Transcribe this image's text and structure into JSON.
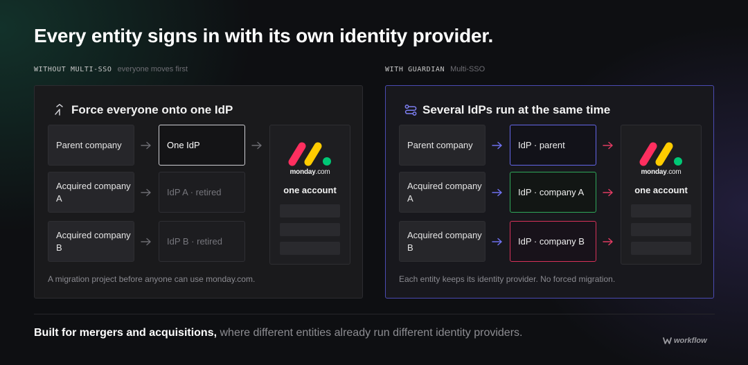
{
  "headline": "Every entity signs in with its own identity provider.",
  "left": {
    "label_code": "WITHOUT MULTI-SSO",
    "label_sub": "everyone moves first",
    "title": "Force everyone onto one IdP",
    "title_icon": "merge-arrow-icon",
    "entities": [
      "Parent company",
      "Acquired company A",
      "Acquired company B"
    ],
    "idps": [
      "One IdP",
      "IdP A · retired",
      "IdP B · retired"
    ],
    "account": {
      "brand": "monday",
      "brand_suffix": ".com",
      "label": "one account"
    },
    "footnote": "A migration project before anyone can use monday.com."
  },
  "right": {
    "label_code": "WITH GUARDIAN",
    "label_sub": "Multi-SSO",
    "title": "Several IdPs run at the same time",
    "title_icon": "routes-icon",
    "entities": [
      "Parent company",
      "Acquired company A",
      "Acquired company B"
    ],
    "idps": [
      "IdP · parent",
      "IdP · company A",
      "IdP · company B"
    ],
    "account": {
      "brand": "monday",
      "brand_suffix": ".com",
      "label": "one account"
    },
    "footnote": "Each entity keeps its identity provider. No forced migration."
  },
  "colors": {
    "idp_parent": "#6466ea",
    "idp_company_a": "#2fa85a",
    "idp_company_b": "#d8325a",
    "panel_border_guardian": "#4b4bb3"
  },
  "tagline": {
    "strong": "Built for mergers and acquisitions,",
    "rest": " where different entities already run different identity providers."
  },
  "watermark": "workflow"
}
